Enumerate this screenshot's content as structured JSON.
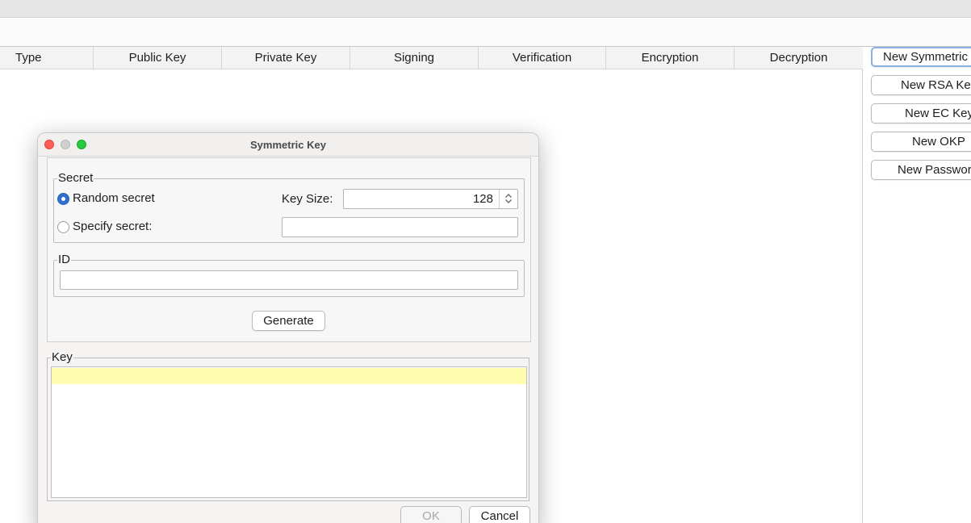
{
  "main_window": {
    "table": {
      "columns": [
        "Type",
        "Public Key",
        "Private Key",
        "Signing",
        "Verification",
        "Encryption",
        "Decryption"
      ]
    },
    "side_buttons": [
      "New Symmetric",
      "New RSA Key",
      "New EC Key",
      "New OKP",
      "New Password"
    ]
  },
  "dialog": {
    "title": "Symmetric Key",
    "secret_group": {
      "label": "Secret",
      "random_label": "Random secret",
      "random_checked": true,
      "specify_label": "Specify secret:",
      "specify_checked": false,
      "key_size_label": "Key Size:",
      "key_size_value": "128",
      "specify_value": ""
    },
    "id_group": {
      "label": "ID",
      "value": ""
    },
    "generate_label": "Generate",
    "key_group": {
      "label": "Key",
      "value": ""
    },
    "ok_label": "OK",
    "cancel_label": "Cancel"
  },
  "colors": {
    "accent": "#2f6fd0",
    "focus_ring": "#8ab0e6",
    "key_highlight": "#fffcb0",
    "close": "#fe5f57",
    "maximize": "#28c840"
  }
}
